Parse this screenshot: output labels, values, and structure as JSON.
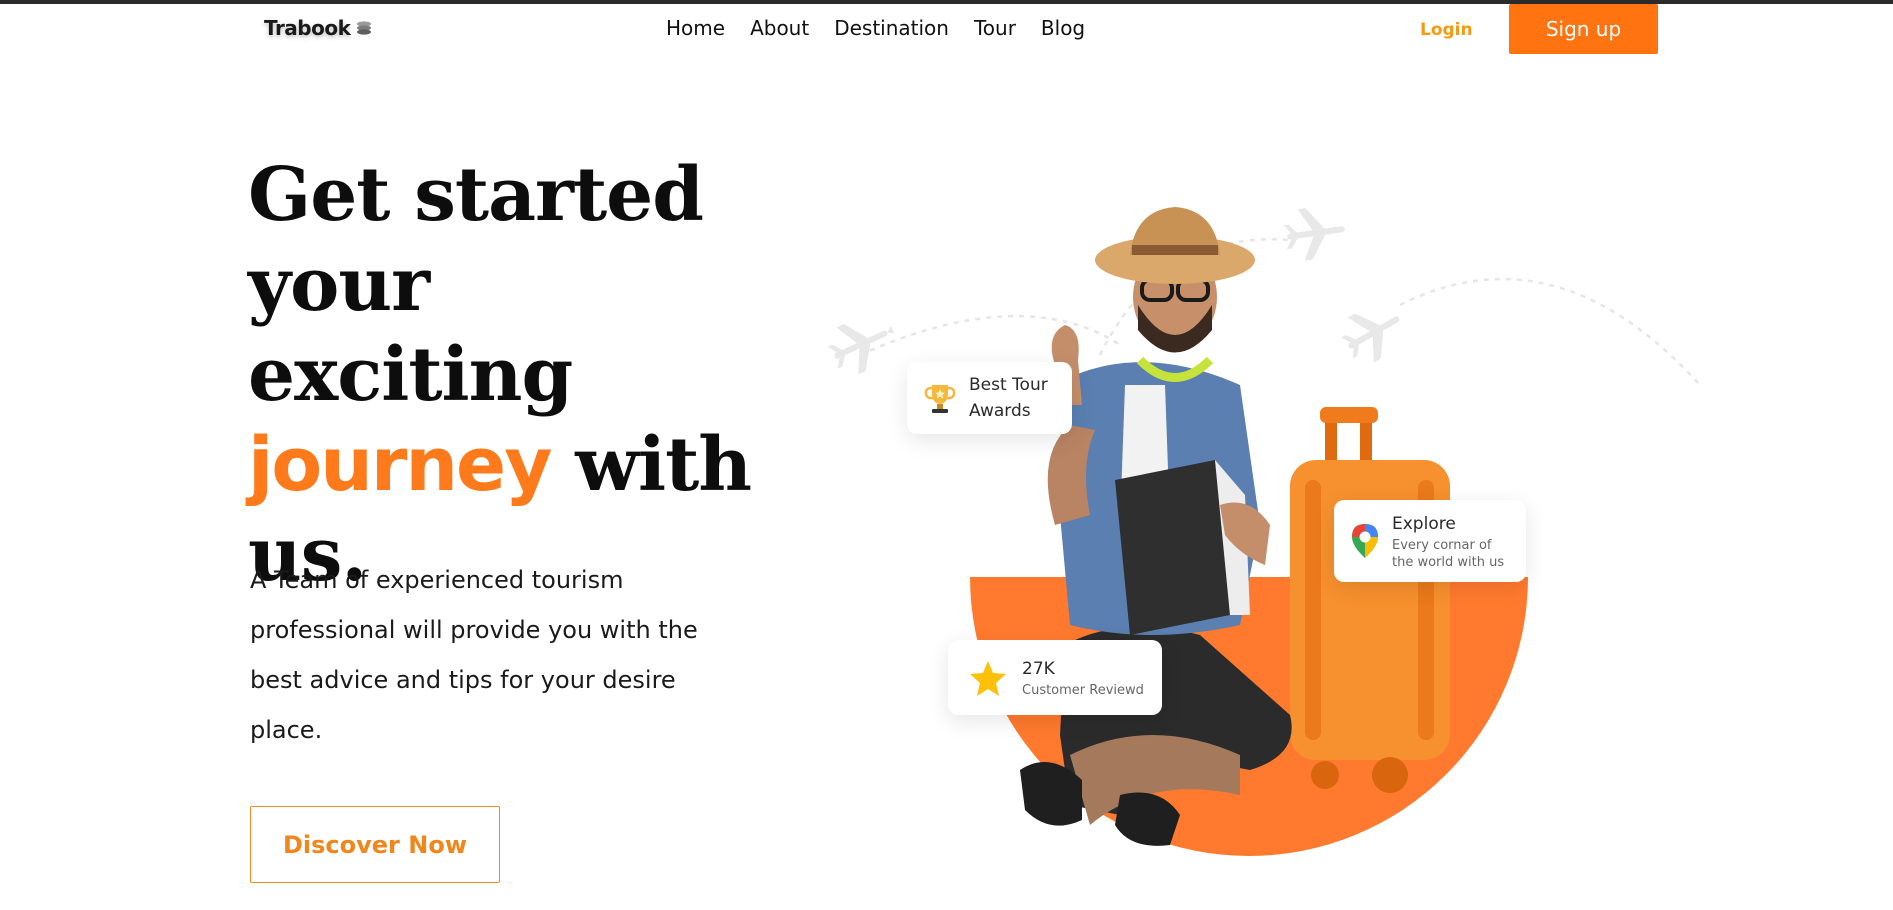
{
  "brand": {
    "name": "Trabook"
  },
  "nav": {
    "items": [
      {
        "label": "Home"
      },
      {
        "label": "About"
      },
      {
        "label": "Destination"
      },
      {
        "label": "Tour"
      },
      {
        "label": "Blog"
      }
    ],
    "login_label": "Login",
    "signup_label": "Sign up"
  },
  "hero": {
    "title_line1": "Get started",
    "title_line2": "your exciting",
    "title_accent": "journey",
    "title_after_accent": " with",
    "title_line4": "us.",
    "description": "A Team of experienced tourism professional will provide you with the best advice and tips for your desire place.",
    "cta_label": "Discover Now"
  },
  "cards": {
    "awards": {
      "title_line1": "Best Tour",
      "title_line2": "Awards",
      "icon": "trophy-icon"
    },
    "explore": {
      "title": "Explore",
      "subtitle_line1": "Every cornar of",
      "subtitle_line2": "the world with us",
      "icon": "map-pin-icon"
    },
    "reviews": {
      "count": "27K",
      "label": "Customer Reviewd",
      "icon": "star-icon"
    }
  },
  "colors": {
    "accent": "#ff7311",
    "accent_text": "#f59a12",
    "circle": "#ff7a2e",
    "star": "#ffc107"
  }
}
